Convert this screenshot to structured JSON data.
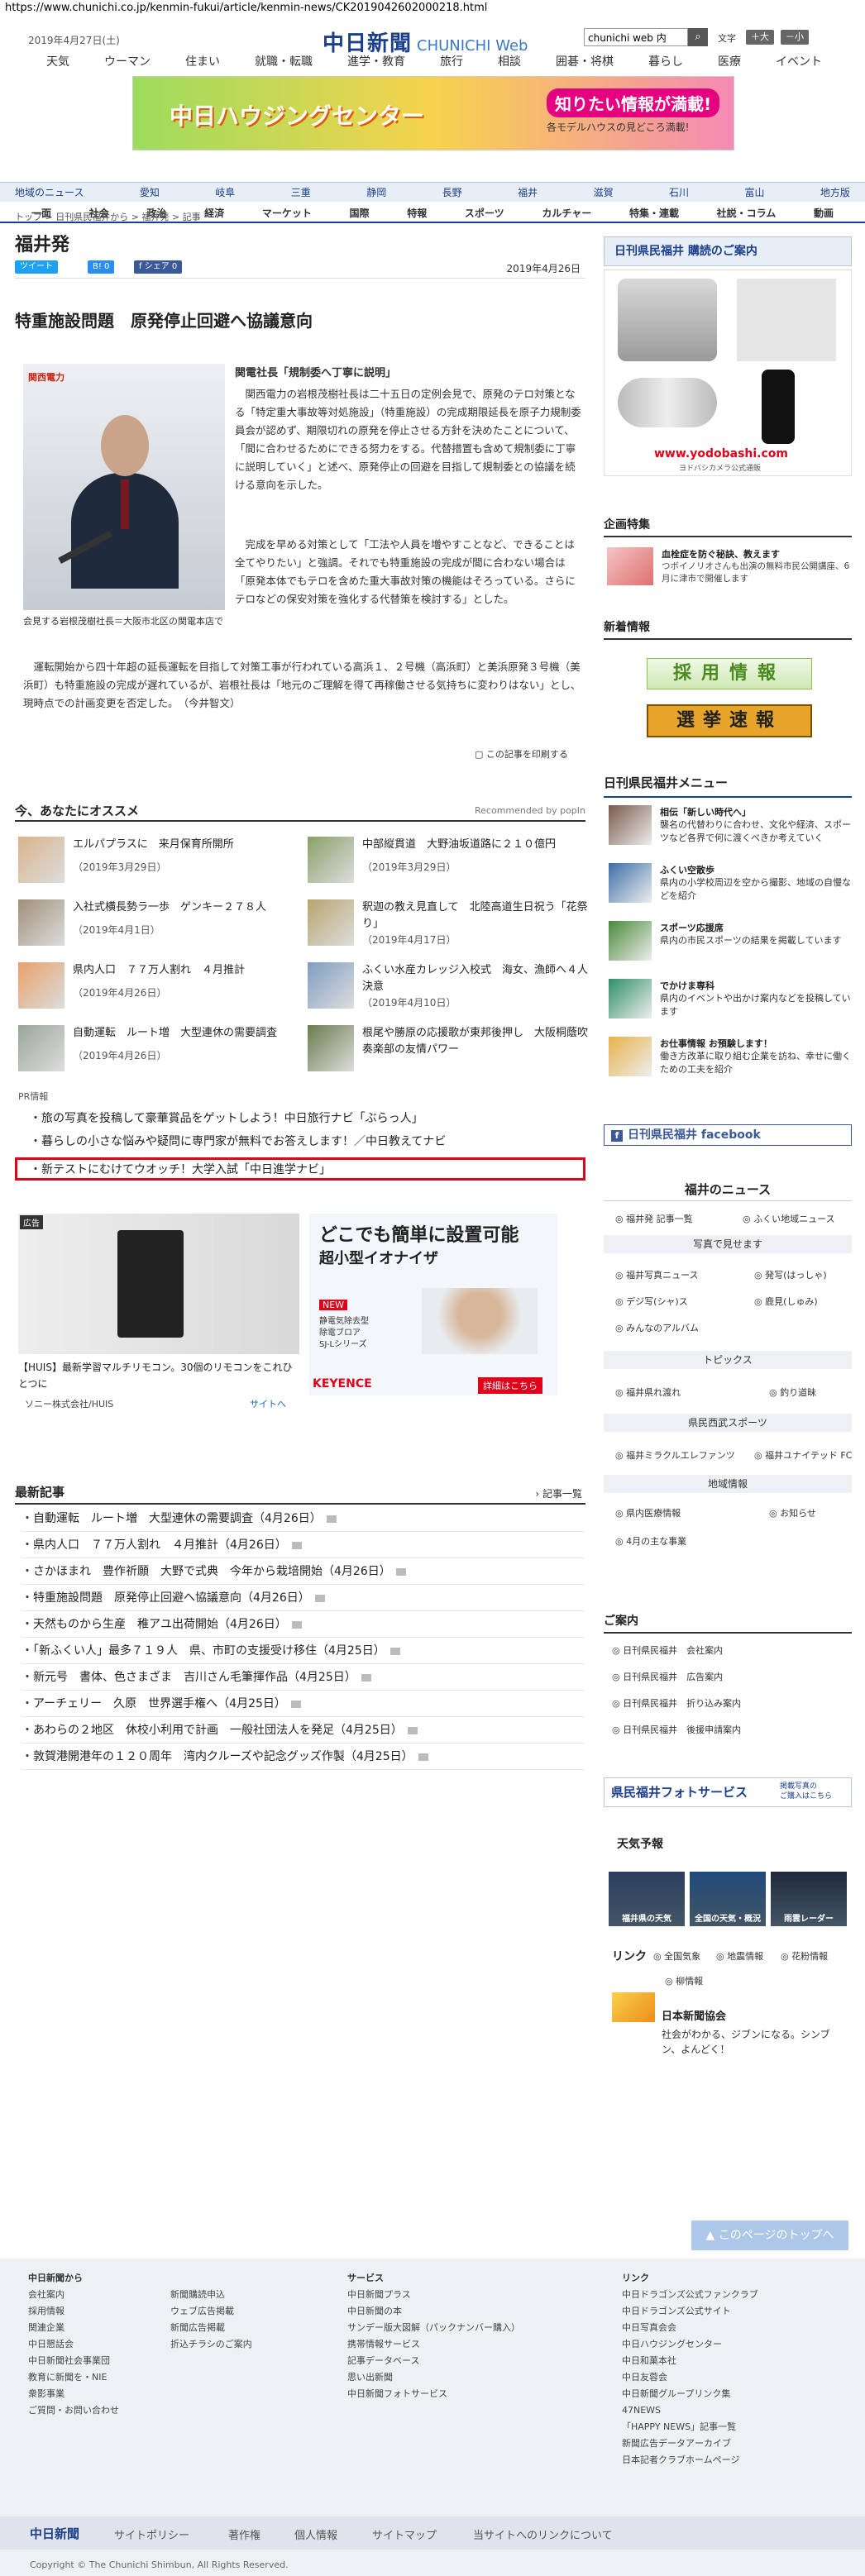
{
  "url": "https://www.chunichi.co.jp/kenmin-fukui/article/kenmin-news/CK2019042602000218.html",
  "header": {
    "date": "2019年4月27日(土)",
    "logo": "中日新聞",
    "logo_sub": "CHUNICHI Web",
    "search_value": "chunichi web 内",
    "fontsize_label": "文字",
    "font_large": "＋大",
    "font_small": "－小",
    "nav1": [
      "天気",
      "ウーマン",
      "住まい",
      "就職・転職",
      "進学・教育",
      "旅行",
      "相談",
      "囲碁・将棋",
      "暮らし",
      "医療",
      "イベント"
    ],
    "ad_title": "中日ハウジングセンター",
    "ad_badge": "知りたい情報が満載!",
    "ad_sub": "各モデルハウスの見どころ満載!",
    "nav2": [
      "地域のニュース",
      "愛知",
      "岐阜",
      "三重",
      "静岡",
      "長野",
      "福井",
      "滋賀",
      "石川",
      "富山",
      "地方版"
    ],
    "nav3": [
      "一面",
      "社会",
      "政治",
      "経済",
      "マーケット",
      "国際",
      "特報",
      "スポーツ",
      "カルチャー",
      "特集・連載",
      "社説・コラム",
      "動画"
    ]
  },
  "article": {
    "breadcrumb": "トップ > 日刊県民福井から > 福井発 > 記事",
    "section": "福井発",
    "share": {
      "tweet": "ツイート",
      "b": "B! 0",
      "fb": "f シェア 0"
    },
    "date": "2019年4月26日",
    "headline": "特重施設問題　原発停止回避へ協議意向",
    "photo_logo": "関西電力",
    "caption": "会見する岩根茂樹社長＝大阪市北区の関電本店で",
    "subhead": "関電社長「規制委へ丁寧に説明」",
    "p1": "　関西電力の岩根茂樹社長は二十五日の定例会見で、原発のテロ対策となる「特定重大事故等対処施設」（特重施設）の完成期限延長を原子力規制委員会が認めず、期限切れの原発を停止させる方針を決めたことについて、「間に合わせるためにできる努力をする。代替措置も含めて規制委に丁寧に説明していく」と述べ、原発停止の回避を目指して規制委との協議を続ける意向を示した。",
    "p2": "　完成を早める対策として「工法や人員を増やすことなど、できることは全てやりたい」と強調。それでも特重施設の完成が間に合わない場合は「原発本体でもテロを含めた重大事故対策の機能はそろっている。さらにテロなどの保安対策を強化する代替策を検討する」とした。",
    "p3": "　運転開始から四十年超の延長運転を目指して対策工事が行われている高浜１、２号機（高浜町）と美浜原発３号機（美浜町）も特重施設の完成が遅れているが、岩根社長は「地元のご理解を得て再稼働させる気持ちに変わりはない」とし、現時点での計画変更を否定した。　（今井智文）",
    "print": "この記事を印刷する"
  },
  "recommend": {
    "title": "今、あなたにオススメ",
    "powered": "Recommended by popIn",
    "items": [
      {
        "title": "エルパプラスに　来月保育所開所",
        "date": "（2019年3月29日）"
      },
      {
        "title": "中部縦貫道　大野油坂道路に２１０億円",
        "date": "（2019年3月29日）"
      },
      {
        "title": "入社式横長勢ラ一歩　ゲンキー２７８人",
        "date": "（2019年4月1日）"
      },
      {
        "title": "釈迦の教え見直して　北陸高道生日祝う「花祭り」",
        "date": "（2019年4月17日）"
      },
      {
        "title": "県内人口　７７万人割れ　４月推計",
        "date": "（2019年4月26日）"
      },
      {
        "title": "ふくい水産カレッジ入校式　海女、漁師へ４人決意",
        "date": "（2019年4月10日）"
      },
      {
        "title": "自動運転　ルート増　大型連休の需要調査",
        "date": "（2019年4月26日）"
      },
      {
        "title": "根尾や勝原の応援歌が東邦後押し　大阪桐蔭吹奏楽部の友情パワー",
        "date": ""
      }
    ]
  },
  "pr": {
    "label": "PR情報",
    "links": [
      "旅の写真を投稿して豪華賞品をゲットしよう！中日旅行ナビ「ぶらっ人」",
      "暮らしの小さな悩みや疑問に専門家が無料でお答えします！／中日教えてナビ",
      "新テストにむけてウオッチ！大学入試「中日進学ナビ」"
    ]
  },
  "ads": {
    "a_label": "広告",
    "a_text": "【HUIS】最新学習マルチリモコン。30個のリモコンをこれひとつに",
    "a_sponsor": "ソニー株式会社/HUIS",
    "a_site": "サイトへ",
    "b_title": "どこでも簡単に設置可能",
    "b_sub": "超小型イオナイザ",
    "b_new": "NEW",
    "b_desc": "静電気除去型\n除電ブロア\nSJ-Lシリーズ",
    "b_brand": "KEYENCE",
    "b_more": "詳細はこちら"
  },
  "latest": {
    "title": "最新記事",
    "more": "記事一覧",
    "items": [
      "自動運転　ルート増　大型連休の需要調査（4月26日）",
      "県内人口　７７万人割れ　４月推計（4月26日）",
      "さかほまれ　豊作祈願　大野で式典　今年から栽培開始（4月26日）",
      "特重施設問題　原発停止回避へ協議意向（4月26日）",
      "天然ものから生産　稚アユ出荷開始（4月26日）",
      "「新ふくい人」最多７１９人　県、市町の支援受け移住（4月25日）",
      "新元号　書体、色さまざま　吉川さん毛筆揮作品（4月25日）",
      "アーチェリー　久原　世界選手権へ（4月25日）",
      "あわらの２地区　休校小利用で計画　一般社団法人を発足（4月25日）",
      "敦賀港開港年の１２０周年　湾内クルーズや記念グッズ作製（4月25日）"
    ]
  },
  "sidebar": {
    "subscribe": "日刊県民福井 購読のご案内",
    "yodo": "www.yodobashi.com",
    "yodo_sub": "ヨドバシカメラ公式通販",
    "kikaku": "企画特集",
    "kikaku_t": "血栓症を防ぐ秘訣、教えます",
    "kikaku_d": "つボイノリオさんも出演の無料市民公開講座、6月に津市で開催します",
    "shinchaku": "新着情報",
    "saiyo": "採用情報",
    "senkyo": "選挙速報",
    "menu_title": "日刊県民福井メニュー",
    "menu": [
      {
        "t": "相伝「新しい時代へ」",
        "d": "襲名の代替わりに合わせ、文化や経済、スポーツなど各界で何に渡くべきか考えていく"
      },
      {
        "t": "ふくい空散歩",
        "d": "県内の小学校周辺を空から撮影、地域の自慢などを紹介"
      },
      {
        "t": "スポーツ応援席",
        "d": "県内の市民スポーツの結果を掲載しています"
      },
      {
        "t": "でかけま専科",
        "d": "県内のイベントや出かけ案内などを投稿しています"
      },
      {
        "t": "お仕事情報 お預験します！",
        "d": "働き方改革に取り組む企業を訪ね、幸せに働くための工夫を紹介"
      }
    ],
    "facebook": "日刊県民福井 facebook",
    "fukui_news": "福井のニュース",
    "fn_tags": [
      "福井発 記事一覧",
      "ふくい地域ニュース"
    ],
    "photo_h": "写真で見せます",
    "photo_tags": [
      "福井写真ニュース",
      "発写(はっしゃ)",
      "デジ写(シャ)ス",
      "鹿見(しゅみ)",
      "みんなのアルバム"
    ],
    "topics_h": "トピックス",
    "topics_tags": [
      "福井県れ渡れ",
      "釣り道昧"
    ],
    "sports_h": "県民西武スポーツ",
    "sports_tags": [
      "福井ミラクルエレファンツ",
      "福井ユナイテッド FC"
    ],
    "region_h": "地域情報",
    "region_tags": [
      "県内医療情報",
      "お知らせ",
      "4月の主な事業"
    ],
    "annai": "ご案内",
    "annai_items": [
      "日刊県民福井　会社案内",
      "日刊県民福井　広告案内",
      "日刊県民福井　折り込み案内",
      "日刊県民福井　後援申請案内"
    ],
    "photo_service": "県民福井フォトサービス",
    "photo_service_sub": "掲載写真の\nご購入はこちら",
    "weather": "天気予報",
    "weather_items": [
      "福井県の天気",
      "全国の天気・概況",
      "雨雲レーダー"
    ],
    "link_h": "リンク",
    "link_tags": [
      "全国気象",
      "地震情報",
      "花粉情報",
      "柳情報"
    ],
    "nippon": "日本新聞協会",
    "nippon_d": "社会がわかる、ジブンになる。シンブン、よんどく！"
  },
  "footer": {
    "top": "このページのトップへ",
    "col1_h": "中日新聞から",
    "col1": [
      "会社案内",
      "採用情報",
      "関連企業",
      "中日懇話会",
      "中日新聞社会事業団",
      "教育に新聞を・NIE",
      "衆影事業",
      "ご質問・お問い合わせ"
    ],
    "col2": [
      "新聞購読申込",
      "ウェブ広告掲載",
      "新聞広告掲載",
      "折込チラシのご案内"
    ],
    "col3_h": "サービス",
    "col3": [
      "中日新聞プラス",
      "中日新聞の本",
      "サンデー版大図解（パックナンバー購入）",
      "携帯情報サービス",
      "記事データベース",
      "思い出新聞",
      "中日新聞フォトサービス"
    ],
    "col4_h": "リンク",
    "col4": [
      "中日ドラゴンズ公式ファンクラブ",
      "中日ドラゴンズ公式サイト",
      "中日写真会会",
      "中日ハウジングセンター",
      "中日和菓本社",
      "中日友蓉会",
      "中日新聞グループリンク集",
      "47NEWS",
      "「HAPPY NEWS」記事一覧",
      "新聞広告データアーカイブ",
      "日本記者クラブホームページ"
    ],
    "bar_logo": "中日新聞",
    "bar": [
      "サイトポリシー",
      "著作権",
      "個人情報",
      "サイトマップ",
      "当サイトへのリンクについて"
    ],
    "copyright": "Copyright © The Chunichi Shimbun, All Rights Reserved."
  },
  "colors": {
    "brand": "#1b3f8b",
    "highlight": "#e0001a",
    "nav_bg": "#e8eef7"
  }
}
